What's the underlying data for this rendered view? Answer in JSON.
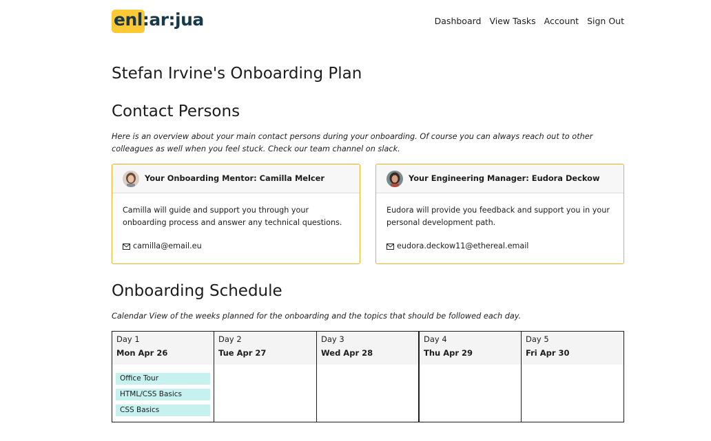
{
  "header": {
    "logo_text": "enl:ar:jua",
    "nav": [
      "Dashboard",
      "View Tasks",
      "Account",
      "Sign Out"
    ]
  },
  "page_title": "Stefan Irvine's Onboarding Plan",
  "contacts": {
    "heading": "Contact Persons",
    "intro": "Here is an overview about your main contact persons during your onboarding. Of course you can always reach out to other colleagues as well when you feel stuck. Check our team channel on slack.",
    "cards": [
      {
        "title": "Your Onboarding Mentor: Camilla Melcer",
        "text": "Camilla will guide and support you through your onboarding process and answer any technical questions.",
        "email": "camilla@email.eu"
      },
      {
        "title": "Your Engineering Manager: Eudora Deckow",
        "text": "Eudora will provide you feedback and support you in your personal development path.",
        "email": "eudora.deckow11@ethereal.email"
      }
    ]
  },
  "schedule": {
    "heading": "Onboarding Schedule",
    "intro": "Calendar View of the weeks planned for the onboarding and the topics that should be followed each day.",
    "days": [
      {
        "label": "Day 1",
        "date": "Mon Apr 26",
        "events": [
          "Office Tour",
          "HTML/CSS Basics",
          "CSS Basics"
        ]
      },
      {
        "label": "Day 2",
        "date": "Tue Apr 27",
        "events": []
      },
      {
        "label": "Day 3",
        "date": "Wed Apr 28",
        "events": []
      },
      {
        "label": "Day 4",
        "date": "Thu Apr 29",
        "events": []
      },
      {
        "label": "Day 5",
        "date": "Fri Apr 30",
        "events": []
      }
    ]
  },
  "colors": {
    "brand_yellow": "#fcc936",
    "brand_navy": "#17394b",
    "card_border": "#f2b01e",
    "event_bg": "#c6f1ef"
  }
}
